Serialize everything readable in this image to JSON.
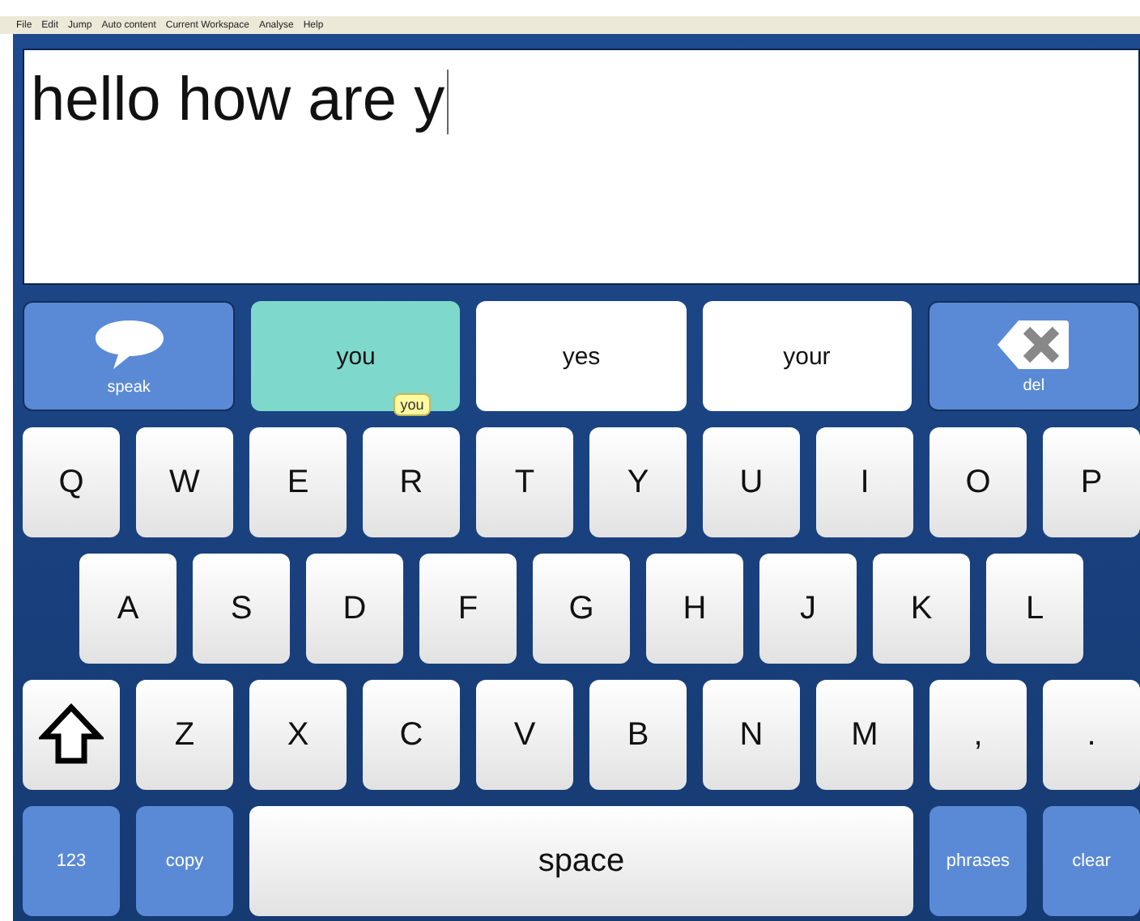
{
  "menu": [
    "File",
    "Edit",
    "Jump",
    "Auto content",
    "Current Workspace",
    "Analyse",
    "Help"
  ],
  "text_box": {
    "value": "hello how are y"
  },
  "predictions": [
    {
      "kind": "speak",
      "label": "speak",
      "selected": false
    },
    {
      "kind": "word",
      "label": "you",
      "selected": true,
      "tooltip": "you"
    },
    {
      "kind": "word",
      "label": "yes",
      "selected": false
    },
    {
      "kind": "word",
      "label": "your",
      "selected": false
    },
    {
      "kind": "delete",
      "label": "del",
      "selected": false
    }
  ],
  "keyboard_rows": [
    [
      {
        "kind": "letter",
        "label": "Q"
      },
      {
        "kind": "letter",
        "label": "W"
      },
      {
        "kind": "letter",
        "label": "E"
      },
      {
        "kind": "letter",
        "label": "R"
      },
      {
        "kind": "letter",
        "label": "T"
      },
      {
        "kind": "letter",
        "label": "Y"
      },
      {
        "kind": "letter",
        "label": "U"
      },
      {
        "kind": "letter",
        "label": "I"
      },
      {
        "kind": "letter",
        "label": "O"
      },
      {
        "kind": "letter",
        "label": "P"
      }
    ],
    [
      {
        "kind": "letter",
        "label": "A"
      },
      {
        "kind": "letter",
        "label": "S"
      },
      {
        "kind": "letter",
        "label": "D"
      },
      {
        "kind": "letter",
        "label": "F"
      },
      {
        "kind": "letter",
        "label": "G"
      },
      {
        "kind": "letter",
        "label": "H"
      },
      {
        "kind": "letter",
        "label": "J"
      },
      {
        "kind": "letter",
        "label": "K"
      },
      {
        "kind": "letter",
        "label": "L"
      }
    ],
    [
      {
        "kind": "shift"
      },
      {
        "kind": "letter",
        "label": "Z"
      },
      {
        "kind": "letter",
        "label": "X"
      },
      {
        "kind": "letter",
        "label": "C"
      },
      {
        "kind": "letter",
        "label": "V"
      },
      {
        "kind": "letter",
        "label": "B"
      },
      {
        "kind": "letter",
        "label": "N"
      },
      {
        "kind": "letter",
        "label": "M"
      },
      {
        "kind": "letter",
        "label": ","
      },
      {
        "kind": "letter",
        "label": "."
      }
    ],
    [
      {
        "kind": "action",
        "label": "123"
      },
      {
        "kind": "action",
        "label": "copy"
      },
      {
        "kind": "space",
        "label": "space"
      },
      {
        "kind": "action",
        "label": "phrases"
      },
      {
        "kind": "action",
        "label": "clear"
      }
    ]
  ]
}
